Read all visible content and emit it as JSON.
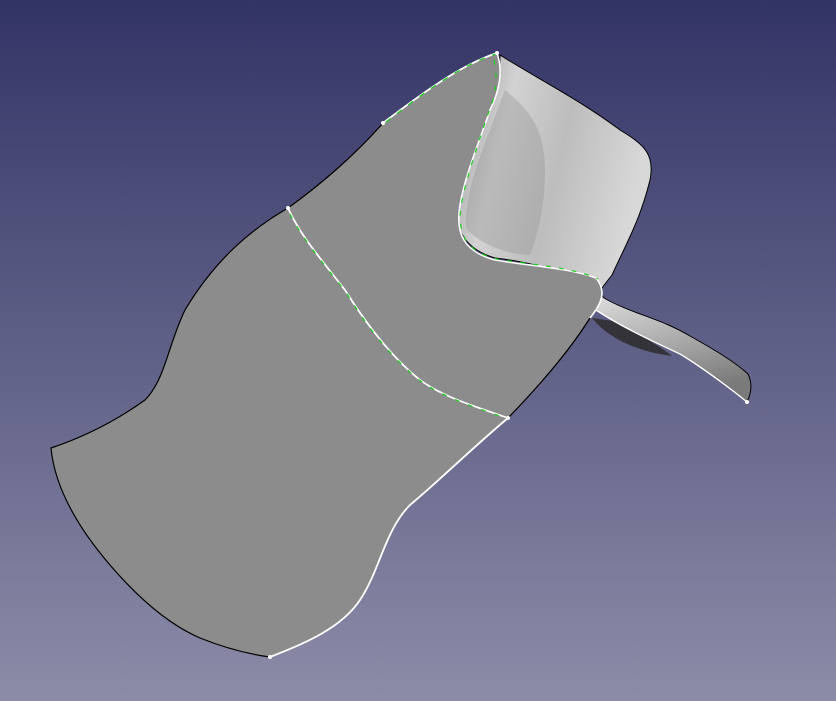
{
  "viewport": {
    "background_top": "#333466",
    "background_bottom": "#8c8ca8"
  },
  "model": {
    "face_color": "#8c8c8c",
    "shaded_light": "#dcdcdc",
    "shaded_mid": "#b4b4b4",
    "shaded_dark": "#6e6e6e",
    "edge_color": "#000000",
    "highlight_edge": "#ffffff",
    "selection_color": "#1ecc1e"
  }
}
